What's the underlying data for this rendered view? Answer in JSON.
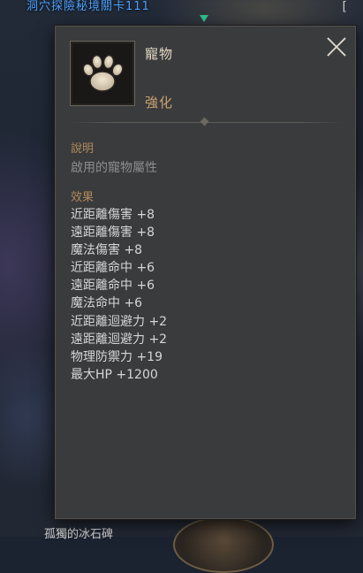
{
  "world": {
    "top_label": "洞穴探險秘境關卡111",
    "bottom_label": "孤獨的冰石碑",
    "hud_icon": "close-bracket-icon"
  },
  "tooltip": {
    "icon": "paw-icon",
    "name": "寵物",
    "type": "強化",
    "close_icon": "close-x-icon",
    "description_title": "說明",
    "description": "啟用的寵物屬性",
    "effects_title": "效果",
    "effects": [
      "近距離傷害 +8",
      "遠距離傷害 +8",
      "魔法傷害 +8",
      "近距離命中 +6",
      "遠距離命中 +6",
      "魔法命中 +6",
      "近距離迴避力 +2",
      "遠距離迴避力 +2",
      "物理防禦力 +19",
      "最大HP +1200"
    ]
  },
  "colors": {
    "panel_bg": "#3a3b3d",
    "name": "#e3d9c2",
    "type": "#c9a270",
    "section_title": "#b08a5c",
    "description": "#8d8d8d",
    "effect_text": "#d6d6d6"
  }
}
